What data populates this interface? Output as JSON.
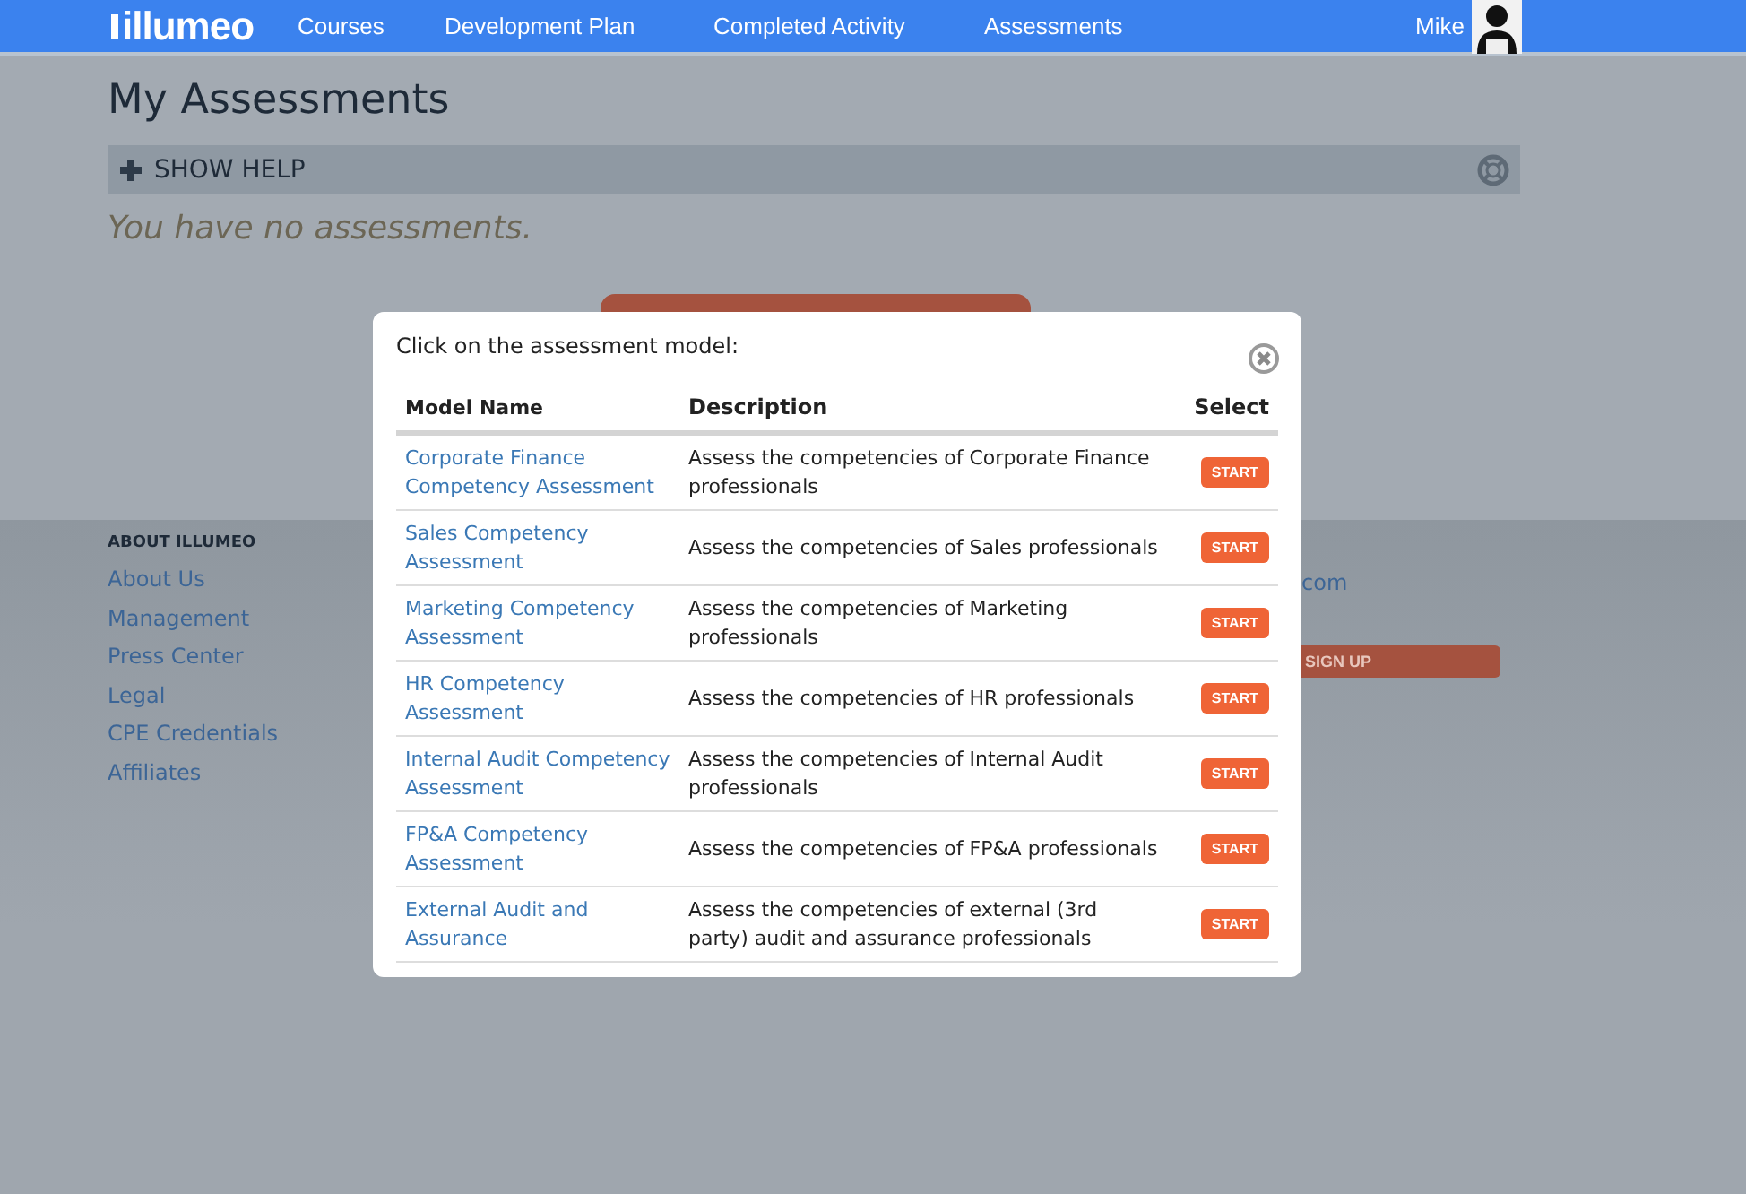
{
  "nav": {
    "logo": "illumeo",
    "items": [
      {
        "label": "Courses"
      },
      {
        "label": "Development Plan"
      },
      {
        "label": "Completed Activity"
      },
      {
        "label": "Assessments"
      }
    ],
    "user": "Mike"
  },
  "page": {
    "title": "My Assessments",
    "help": "SHOW HELP",
    "empty": "You have no assessments."
  },
  "footer": {
    "heading": "ABOUT ILLUMEO",
    "links": [
      "About Us",
      "Management",
      "Press Center",
      "Legal",
      "CPE Credentials",
      "Affiliates"
    ],
    "contact_fragment": "com",
    "signup": "SIGN UP"
  },
  "modal": {
    "prompt": "Click on the assessment model:",
    "columns": [
      "Model Name",
      "Description",
      "Select"
    ],
    "rows": [
      {
        "name": "Corporate Finance Competency Assessment",
        "description": "Assess the competencies of Corporate Finance professionals",
        "action": "START"
      },
      {
        "name": "Sales Competency Assessment",
        "description": "Assess the competencies of Sales professionals",
        "action": "START"
      },
      {
        "name": "Marketing Competency Assessment",
        "description": "Assess the competencies of Marketing professionals",
        "action": "START"
      },
      {
        "name": "HR Competency Assessment",
        "description": "Assess the competencies of HR professionals",
        "action": "START"
      },
      {
        "name": "Internal Audit Competency Assessment",
        "description": "Assess the competencies of Internal Audit professionals",
        "action": "START"
      },
      {
        "name": "FP&A Competency Assessment",
        "description": "Assess the competencies of FP&A professionals",
        "action": "START"
      },
      {
        "name": "External Audit and Assurance",
        "description": "Assess the competencies of external (3rd party) audit and assurance professionals",
        "action": "START"
      }
    ]
  }
}
